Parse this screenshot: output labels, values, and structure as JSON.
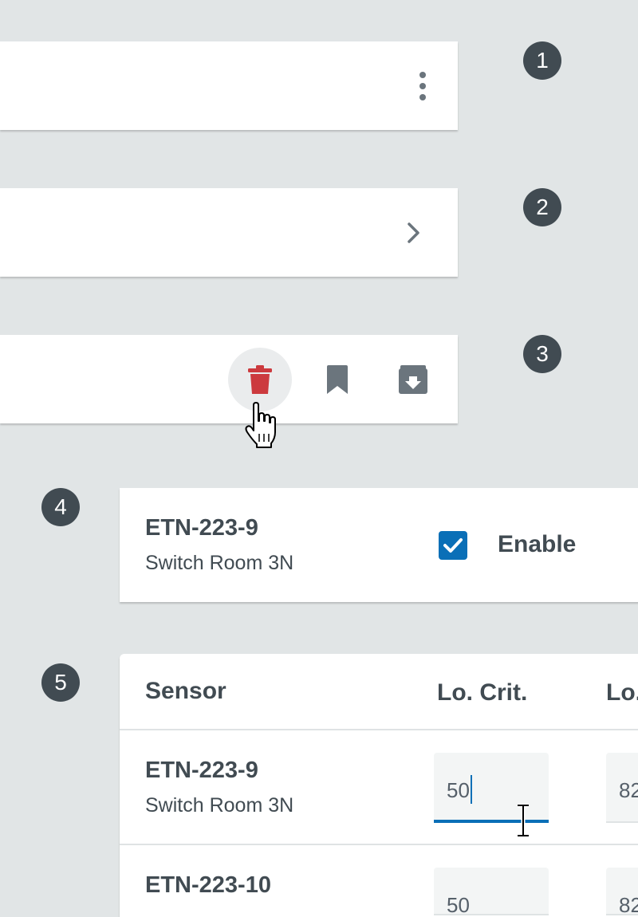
{
  "badges": [
    "1",
    "2",
    "3",
    "4",
    "5"
  ],
  "row1": {
    "menu_icon": "more-vertical-icon"
  },
  "row2": {
    "chevron_icon": "chevron-right-icon"
  },
  "row3": {
    "actions": [
      {
        "name": "delete",
        "icon": "trash-icon",
        "color": "#cc3a3e",
        "hovered": true
      },
      {
        "name": "bookmark",
        "icon": "bookmark-icon",
        "color": "#6b757d"
      },
      {
        "name": "archive",
        "icon": "archive-icon",
        "color": "#6b757d"
      }
    ]
  },
  "device_card": {
    "title": "ETN-223-9",
    "subtitle": "Switch Room 3N",
    "checkbox": {
      "checked": true,
      "label": "Enable",
      "color": "#0a6fb7"
    }
  },
  "sensor_table": {
    "headers": [
      "Sensor",
      "Lo. Crit.",
      "Lo."
    ],
    "rows": [
      {
        "title": "ETN-223-9",
        "subtitle": "Switch Room 3N",
        "lo_crit": "50",
        "lo": "82"
      },
      {
        "title": "ETN-223-10",
        "lo_crit": "50",
        "lo": "82"
      }
    ]
  },
  "colors": {
    "background": "#e1e5e6",
    "accent": "#0a6fb7",
    "danger": "#cc3a3e",
    "badge": "#414b52"
  }
}
